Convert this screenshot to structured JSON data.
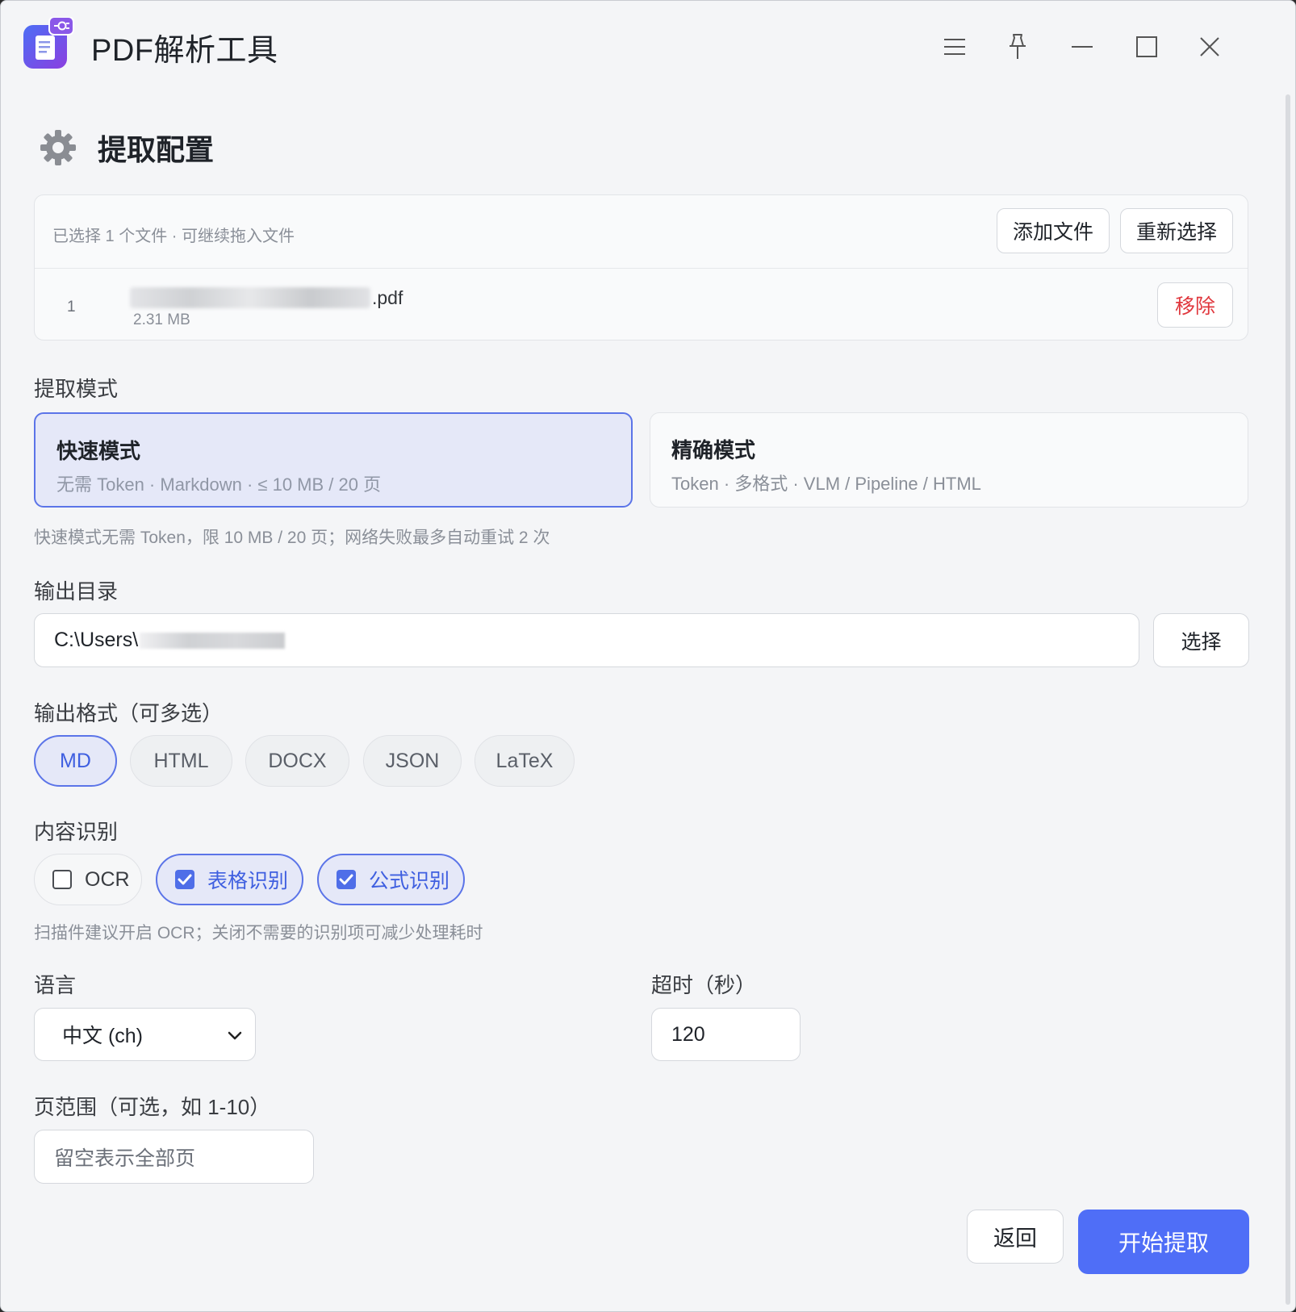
{
  "app": {
    "title": "PDF解析工具"
  },
  "window_controls": [
    "menu-icon",
    "pin-icon",
    "minimize-icon",
    "maximize-icon",
    "close-icon"
  ],
  "section": {
    "title": "提取配置",
    "icon": "gear-icon"
  },
  "files": {
    "hint": "已选择 1 个文件 · 可继续拖入文件",
    "add_label": "添加文件",
    "reselect_label": "重新选择",
    "items": [
      {
        "index": "1",
        "name_ext": ".pdf",
        "size": "2.31 MB",
        "remove_label": "移除"
      }
    ]
  },
  "mode": {
    "label": "提取模式",
    "options": [
      {
        "title": "快速模式",
        "desc": "无需 Token · Markdown · ≤ 10 MB / 20 页",
        "selected": true
      },
      {
        "title": "精确模式",
        "desc": "Token · 多格式 · VLM / Pipeline / HTML",
        "selected": false
      }
    ],
    "hint": "快速模式无需 Token，限 10 MB / 20 页；网络失败最多自动重试 2 次"
  },
  "output_dir": {
    "label": "输出目录",
    "value": "C:\\Users\\",
    "choose_label": "选择"
  },
  "formats": {
    "label": "输出格式（可多选）",
    "options": [
      {
        "label": "MD",
        "selected": true
      },
      {
        "label": "HTML",
        "selected": false
      },
      {
        "label": "DOCX",
        "selected": false
      },
      {
        "label": "JSON",
        "selected": false
      },
      {
        "label": "LaTeX",
        "selected": false
      }
    ]
  },
  "recognition": {
    "label": "内容识别",
    "options": [
      {
        "label": "OCR",
        "checked": false
      },
      {
        "label": "表格识别",
        "checked": true
      },
      {
        "label": "公式识别",
        "checked": true
      }
    ],
    "hint": "扫描件建议开启 OCR；关闭不需要的识别项可减少处理耗时"
  },
  "language": {
    "label": "语言",
    "value": "中文 (ch)"
  },
  "timeout": {
    "label": "超时（秒）",
    "value": "120"
  },
  "page_range": {
    "label": "页范围（可选，如 1-10）",
    "placeholder": "留空表示全部页"
  },
  "actions": {
    "back_label": "返回",
    "start_label": "开始提取"
  },
  "colors": {
    "accent": "#4f6ef7",
    "danger": "#e0383e",
    "selected_bg": "#e5e8f8"
  }
}
